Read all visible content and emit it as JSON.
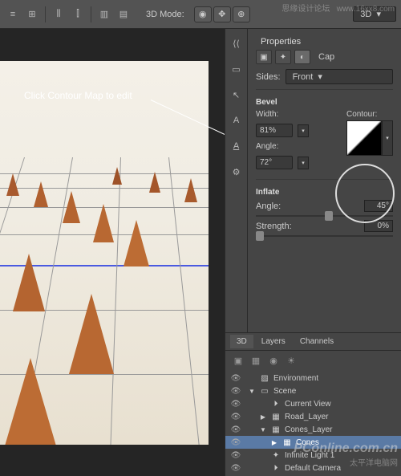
{
  "toolbar": {
    "mode_label": "3D Mode:",
    "top_select": "3D"
  },
  "annotation": "Click Contour Map to edit",
  "properties": {
    "panel_title": "Properties",
    "type_label": "Cap",
    "sides_label": "Sides:",
    "sides_value": "Front",
    "bevel_label": "Bevel",
    "width_label": "Width:",
    "width_value": "81%",
    "angle_label": "Angle:",
    "angle_value": "72°",
    "contour_label": "Contour:",
    "inflate_label": "Inflate",
    "inflate_angle_label": "Angle:",
    "inflate_angle_value": "45°",
    "strength_label": "Strength:",
    "strength_value": "0%"
  },
  "panel3d": {
    "tabs": [
      "3D",
      "Layers",
      "Channels"
    ],
    "items": [
      {
        "name": "Environment",
        "icon": "env",
        "indent": 0,
        "tw": ""
      },
      {
        "name": "Scene",
        "icon": "scene",
        "indent": 0,
        "tw": "▼"
      },
      {
        "name": "Current View",
        "icon": "cam",
        "indent": 1,
        "tw": ""
      },
      {
        "name": "Road_Layer",
        "icon": "mesh",
        "indent": 1,
        "tw": "▶"
      },
      {
        "name": "Cones_Layer",
        "icon": "mesh",
        "indent": 1,
        "tw": "▼"
      },
      {
        "name": "Cones",
        "icon": "mesh",
        "indent": 2,
        "tw": "▶",
        "selected": true
      },
      {
        "name": "Infinite Light 1",
        "icon": "light",
        "indent": 1,
        "tw": ""
      },
      {
        "name": "Default Camera",
        "icon": "cam",
        "indent": 1,
        "tw": ""
      }
    ]
  },
  "watermarks": {
    "top_left": "思缘设计论坛",
    "top_right": "www.16xx8.com",
    "bottom_logo": "PConline.com.cn",
    "bottom_sub": "太平洋电脑网"
  }
}
